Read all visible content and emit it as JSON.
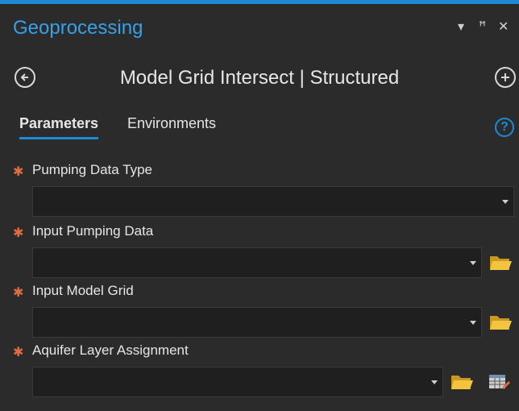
{
  "pane": {
    "title": "Geoprocessing",
    "controls": {
      "dropdown": "▾",
      "pin": "ꟸ",
      "close": "✕"
    }
  },
  "tool": {
    "title": "Model Grid Intersect | Structured"
  },
  "tabs": [
    {
      "label": "Parameters",
      "active": true
    },
    {
      "label": "Environments",
      "active": false
    }
  ],
  "help": {
    "label": "?"
  },
  "required_marker": "✱",
  "parameters": [
    {
      "label": "Pumping Data Type",
      "value": "",
      "has_browse": false,
      "has_table": false
    },
    {
      "label": "Input Pumping Data",
      "value": "",
      "has_browse": true,
      "has_table": false
    },
    {
      "label": "Input Model Grid",
      "value": "",
      "has_browse": true,
      "has_table": false
    },
    {
      "label": "Aquifer Layer Assignment",
      "value": "",
      "has_browse": true,
      "has_table": true
    }
  ],
  "colors": {
    "accent": "#1e8ad6",
    "title": "#35a1ea",
    "required": "#e36b3d",
    "folder": "#f3c43d",
    "background": "#2b2b2b",
    "field": "#1f1f1f"
  },
  "icons": {
    "back": "back-arrow-icon",
    "add": "add-icon",
    "help": "help-icon",
    "browse": "folder-icon",
    "table": "table-edit-icon"
  }
}
